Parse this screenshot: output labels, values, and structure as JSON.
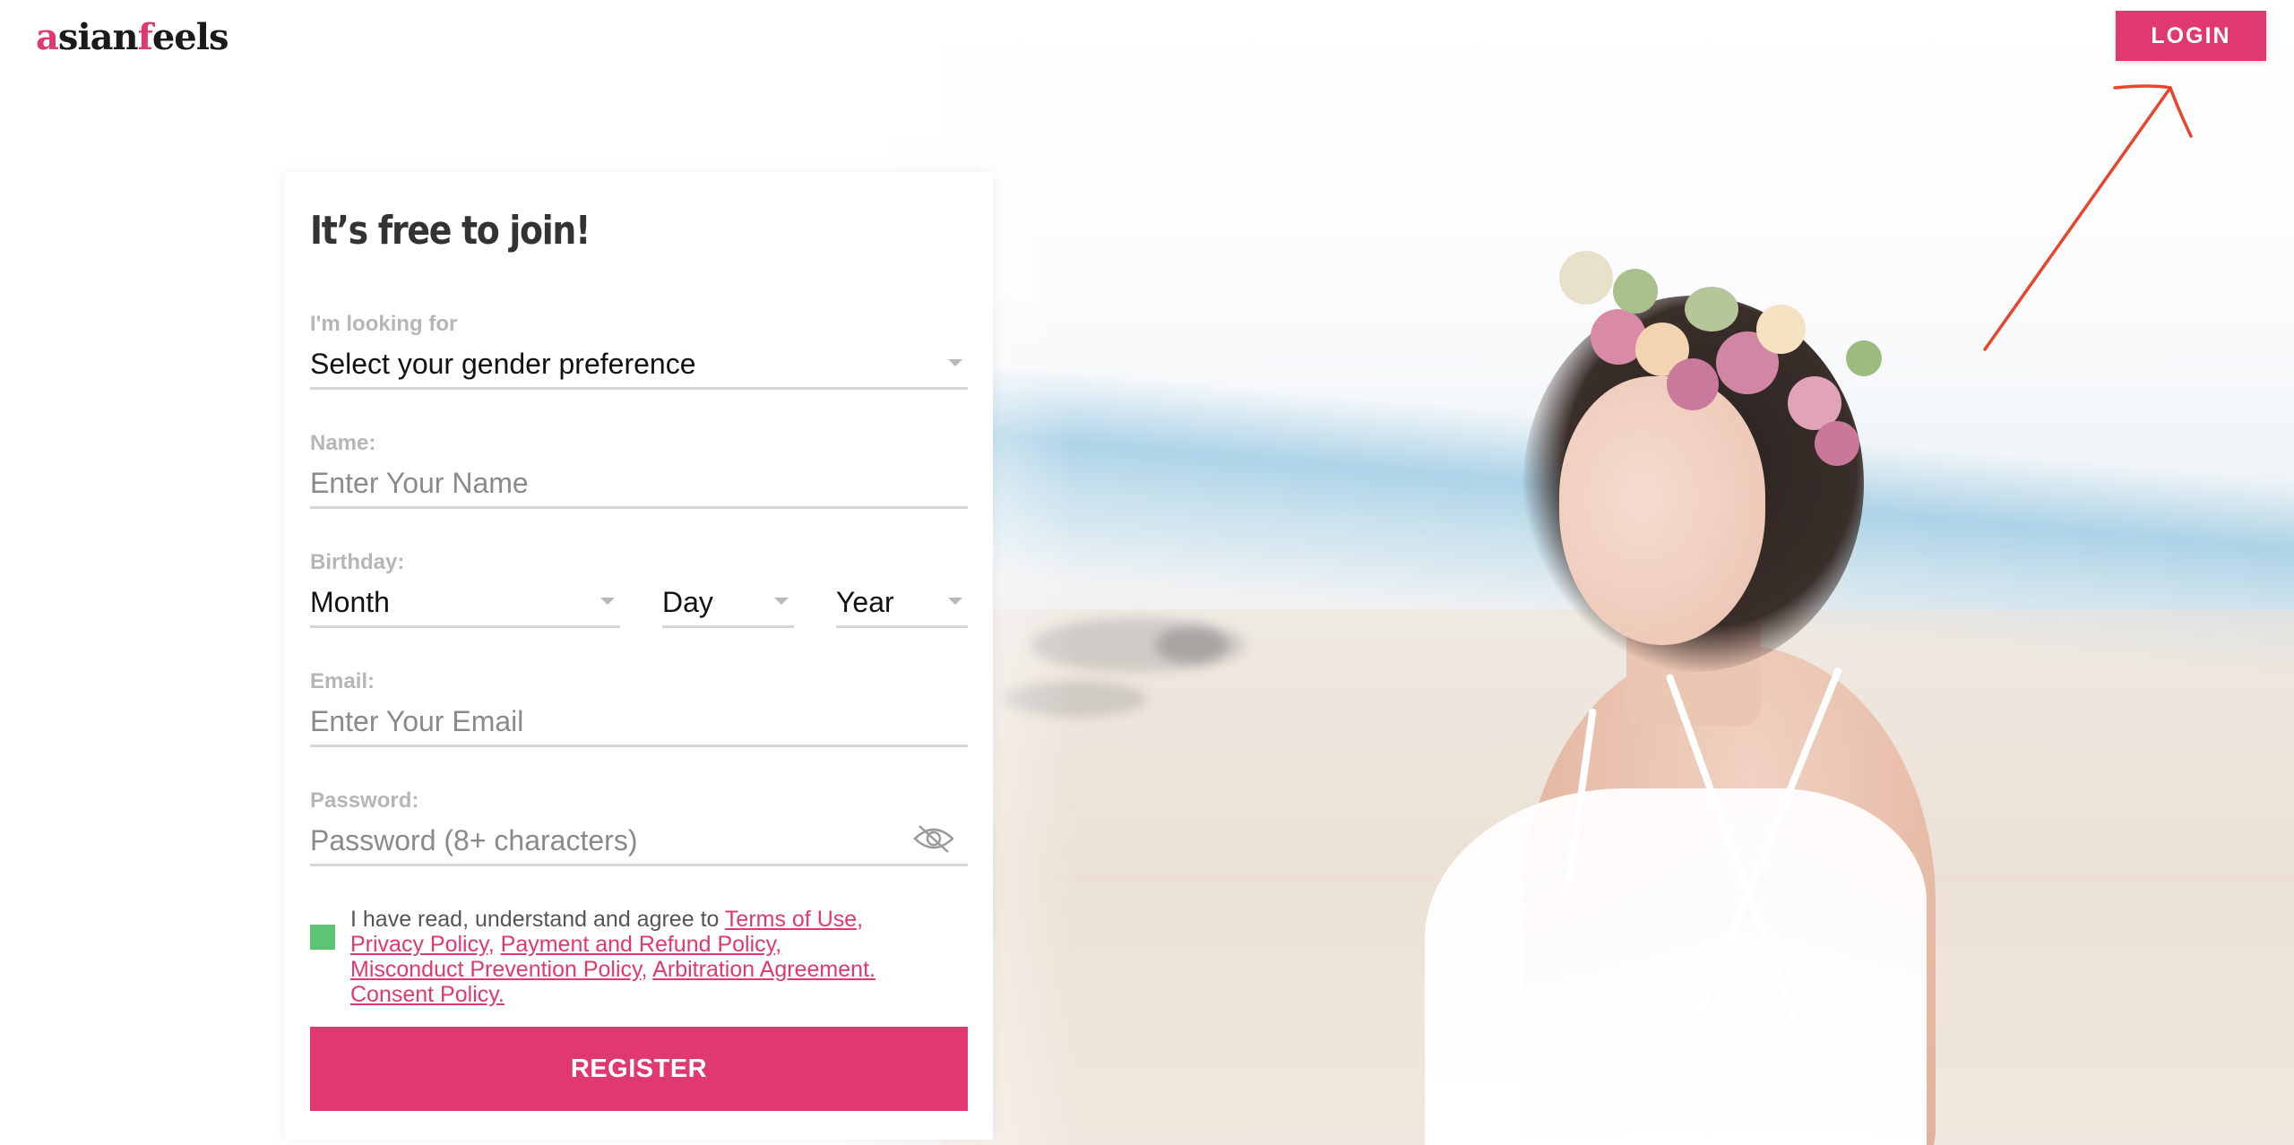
{
  "header": {
    "logo_prefix": "a",
    "logo_middle": "sian",
    "logo_f": "f",
    "logo_suffix": "eels",
    "login_label": "LOGIN"
  },
  "form": {
    "title": "It’s free to join!",
    "looking_for": {
      "label": "I'm looking for",
      "value": "Select your gender preference"
    },
    "name": {
      "label": "Name:",
      "placeholder": "Enter Your Name"
    },
    "birthday": {
      "label": "Birthday:",
      "month": "Month",
      "day": "Day",
      "year": "Year"
    },
    "email": {
      "label": "Email:",
      "placeholder": "Enter Your Email"
    },
    "password": {
      "label": "Password:",
      "placeholder": "Password (8+ characters)"
    },
    "agreement": {
      "text": "I have read, understand and agree to ",
      "terms": "Terms of Use,",
      "privacy": "Privacy Policy,",
      "payment": "Payment and Refund Policy,",
      "misconduct": "Misconduct Prevention Policy,",
      "arbitration": "Arbitration Agreement.",
      "consent": "Consent Policy."
    },
    "register_label": "REGISTER"
  },
  "colors": {
    "brand": "#e0396f",
    "checkbox": "#5cc475",
    "annotation_arrow": "#e6462e"
  }
}
